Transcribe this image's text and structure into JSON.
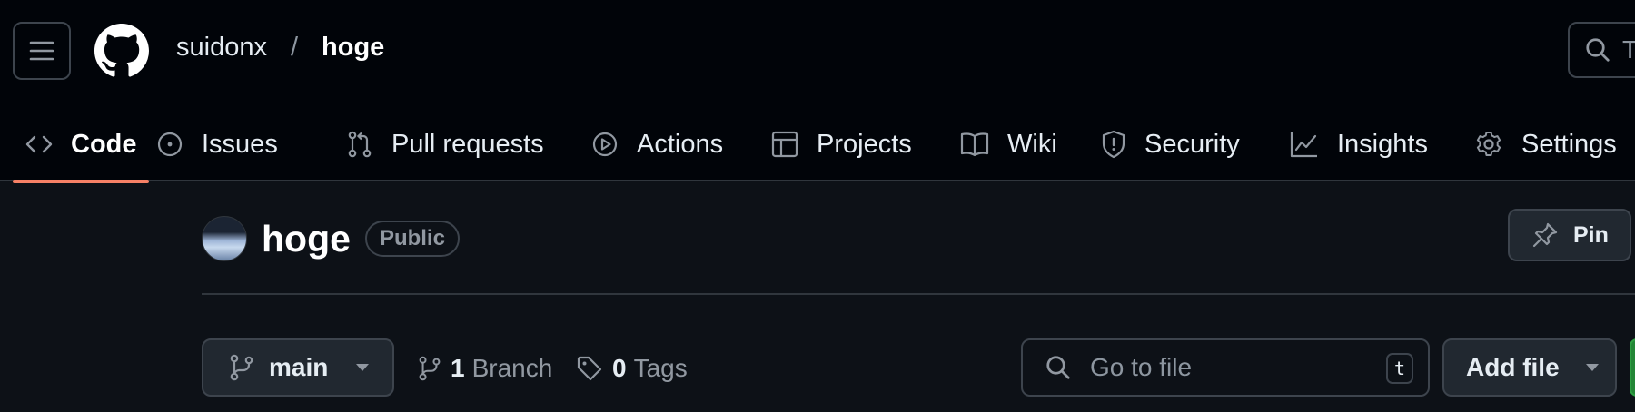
{
  "header": {
    "owner": "suidonx",
    "separator": "/",
    "repo": "hoge",
    "search_placeholder": "T"
  },
  "tabs": [
    {
      "label": "Code",
      "icon": "code-icon",
      "active": true
    },
    {
      "label": "Issues",
      "icon": "issue-opened-icon"
    },
    {
      "label": "Pull requests",
      "icon": "git-pull-request-icon"
    },
    {
      "label": "Actions",
      "icon": "play-icon"
    },
    {
      "label": "Projects",
      "icon": "table-icon"
    },
    {
      "label": "Wiki",
      "icon": "book-icon"
    },
    {
      "label": "Security",
      "icon": "shield-icon"
    },
    {
      "label": "Insights",
      "icon": "graph-icon"
    },
    {
      "label": "Settings",
      "icon": "gear-icon"
    }
  ],
  "repo": {
    "name": "hoge",
    "visibility": "Public",
    "pin_label": "Pin"
  },
  "toolbar": {
    "branch": "main",
    "branch_count": "1",
    "branch_label": "Branch",
    "tag_count": "0",
    "tag_label": "Tags",
    "goto_placeholder": "Go to file",
    "goto_shortcut": "t",
    "add_file_label": "Add file"
  },
  "colors": {
    "header_bg": "#010409",
    "page_bg": "#0d1117",
    "active_tab_underline": "#f78166",
    "border": "#3d444d",
    "button_bg": "#212830",
    "primary_green": "#238636"
  }
}
